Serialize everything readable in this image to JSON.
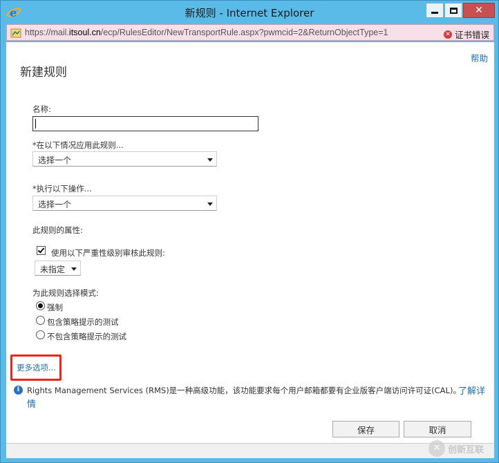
{
  "window": {
    "title": "新规则 - Internet Explorer",
    "address_url_prefix": "https://mail.",
    "address_url_host": "itsoul.cn",
    "address_url_path": "/ecp/RulesEditor/NewTransportRule.aspx?pwmcid=2&ReturnObjectType=1",
    "cert_error": "证书错误"
  },
  "header": {
    "help": "帮助",
    "page_title": "新建规则"
  },
  "form": {
    "name_label": "名称:",
    "name_value": "",
    "condition_label": "*在以下情况应用此规则...",
    "condition_select": "选择一个",
    "action_label": "*执行以下操作...",
    "action_select": "选择一个",
    "properties_label": "此规则的属性:",
    "audit_checkbox_label": "使用以下严重性级别审核此规则:",
    "audit_checked": true,
    "severity_select": "未指定",
    "mode_label": "为此规则选择模式:",
    "modes": [
      {
        "label": "强制",
        "selected": true
      },
      {
        "label": "包含策略提示的测试",
        "selected": false
      },
      {
        "label": "不包含策略提示的测试",
        "selected": false
      }
    ],
    "more_options": "更多选项..."
  },
  "info": {
    "text": "Rights Management Services (RMS)是一种高级功能，该功能要求每个用户邮箱都要有企业版客户端访问许可证(CAL)。",
    "learn_more_1": "了解详",
    "learn_more_2": "情"
  },
  "buttons": {
    "save": "保存",
    "cancel": "取消"
  },
  "watermark": {
    "text": "创新互联"
  },
  "colors": {
    "titlebar": "#5bbbe8",
    "link": "#1f6fa8",
    "highlight_box": "#e8261c",
    "address_bar_error": "#f7dfe7"
  }
}
